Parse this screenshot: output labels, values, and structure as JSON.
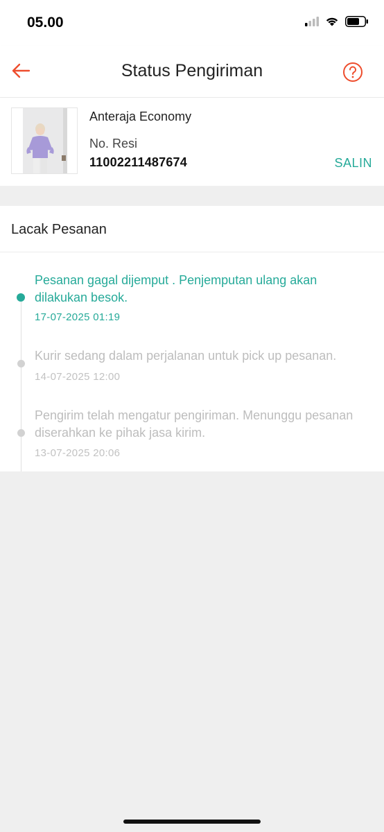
{
  "status_bar": {
    "time": "05.00",
    "icons": [
      "cellular-signal-icon",
      "wifi-icon",
      "battery-icon"
    ]
  },
  "header": {
    "title": "Status Pengiriman",
    "back_icon": "arrow-left-icon",
    "help_icon": "question-circle-icon"
  },
  "shipment": {
    "courier": "Anteraja Economy",
    "resi_label": "No. Resi",
    "resi_number": "11002211487674",
    "copy_label": "SALIN",
    "thumbnail": "product-photo"
  },
  "tracking": {
    "title": "Lacak Pesanan",
    "events": [
      {
        "text": "Pesanan gagal dijemput . Penjemputan ulang akan dilakukan besok.",
        "time": "17-07-2025 01:19",
        "active": true
      },
      {
        "text": "Kurir sedang dalam perjalanan untuk pick up pesanan.",
        "time": "14-07-2025 12:00",
        "active": false
      },
      {
        "text": "Pengirim telah mengatur pengiriman. Menunggu pesanan diserahkan ke pihak jasa kirim.",
        "time": "13-07-2025 20:06",
        "active": false
      }
    ]
  },
  "colors": {
    "accent_orange": "#ee4d2d",
    "teal": "#26aa99",
    "muted_text": "#bdbdbd",
    "background": "#efefef"
  }
}
